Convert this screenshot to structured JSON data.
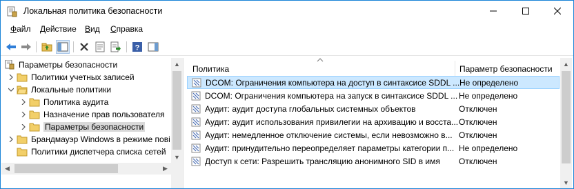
{
  "window": {
    "title": "Локальная политика безопасности"
  },
  "menu": [
    {
      "label": "Файл",
      "accel": "Ф",
      "rest": "айл"
    },
    {
      "label": "Действие",
      "accel": "Д",
      "rest": "ействие"
    },
    {
      "label": "Вид",
      "accel": "В",
      "rest": "ид"
    },
    {
      "label": "Справка",
      "accel": "С",
      "rest": "правка"
    }
  ],
  "toolbar": {
    "icons": [
      "back-icon",
      "forward-icon",
      "up-folder-icon",
      "show-hide-tree-icon",
      "delete-icon",
      "properties-icon",
      "export-list-icon",
      "help-icon",
      "show-hide-action-pane-icon"
    ]
  },
  "tree": {
    "items": [
      {
        "label": "Параметры безопасности",
        "level": 0,
        "chevron": "none",
        "icon": "security-settings-icon"
      },
      {
        "label": "Политики учетных записей",
        "level": 1,
        "chevron": "right",
        "icon": "folder-icon"
      },
      {
        "label": "Локальные политики",
        "level": 1,
        "chevron": "down",
        "icon": "folder-open-icon"
      },
      {
        "label": "Политика аудита",
        "level": 2,
        "chevron": "right",
        "icon": "folder-icon"
      },
      {
        "label": "Назначение прав пользователя",
        "level": 2,
        "chevron": "right",
        "icon": "folder-icon"
      },
      {
        "label": "Параметры безопасности",
        "level": 2,
        "chevron": "right",
        "icon": "folder-icon",
        "selected": true
      },
      {
        "label": "Брандмауэр Windows в режиме пові",
        "level": 1,
        "chevron": "right",
        "icon": "folder-icon"
      },
      {
        "label": "Политики диспетчера списка сетей",
        "level": 1,
        "chevron": "none",
        "icon": "folder-icon"
      }
    ]
  },
  "list": {
    "columns": {
      "policy": "Политика",
      "setting": "Параметр безопасности"
    },
    "rows": [
      {
        "policy": "DCOM: Ограничения компьютера на доступ в синтаксисе SDDL ...",
        "setting": "Не определено",
        "selected": true
      },
      {
        "policy": "DCOM: Ограничения компьютера на запуск в синтаксисе SDDL ...",
        "setting": "Не определено"
      },
      {
        "policy": "Аудит: аудит доступа глобальных системных объектов",
        "setting": "Отключен"
      },
      {
        "policy": "Аудит: аудит использования привилегии на архивацию и восста...",
        "setting": "Отключен"
      },
      {
        "policy": "Аудит: немедленное отключение системы, если невозможно в...",
        "setting": "Отключен"
      },
      {
        "policy": "Аудит: принудительно переопределяет параметры категории п...",
        "setting": "Не определено"
      },
      {
        "policy": "Доступ к сети: Разрешить трансляцию анонимного SID в имя",
        "setting": "Отключен"
      }
    ]
  },
  "colors": {
    "selection_row": "#cce8ff",
    "selection_border": "#99d1ff",
    "tree_selected": "#d9d9d9",
    "window_border": "#1883d7"
  }
}
